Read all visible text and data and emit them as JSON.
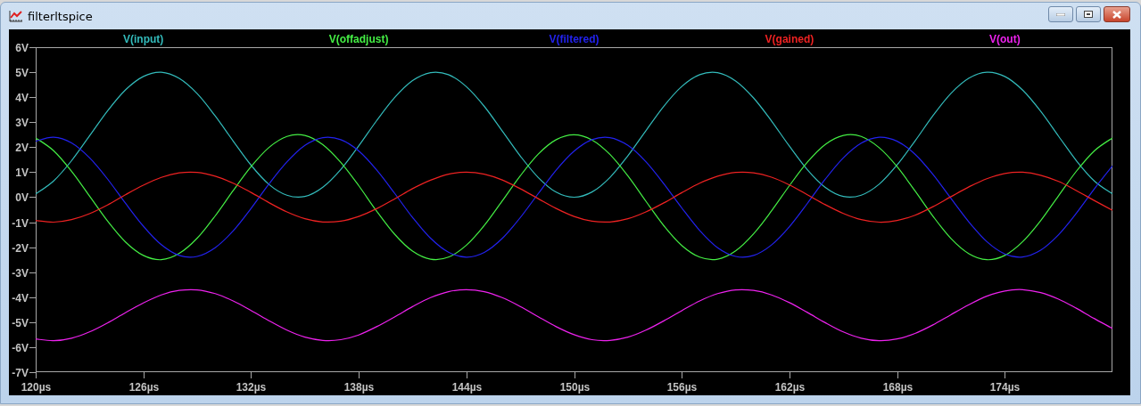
{
  "window": {
    "title": "filterltspice"
  },
  "plot": {
    "chart_data": {
      "type": "line",
      "x": [
        120,
        121,
        122,
        123,
        124,
        125,
        126,
        127,
        128,
        129,
        130,
        131,
        132,
        133,
        134,
        135,
        136,
        137,
        138,
        139,
        140,
        141,
        142,
        143,
        144,
        145,
        146,
        147,
        148,
        149,
        150,
        151,
        152,
        153,
        154,
        155,
        156,
        157,
        158,
        159,
        160,
        161,
        162,
        163,
        164,
        165,
        166,
        167,
        168,
        169,
        170,
        171,
        172,
        173,
        174,
        175,
        176,
        177,
        178,
        179,
        180
      ],
      "xlim": [
        120,
        180
      ],
      "ylim": [
        -7,
        6
      ],
      "xticks": [
        {
          "value": 120,
          "label": "120µs"
        },
        {
          "value": 126,
          "label": "126µs"
        },
        {
          "value": 132,
          "label": "132µs"
        },
        {
          "value": 138,
          "label": "138µs"
        },
        {
          "value": 144,
          "label": "144µs"
        },
        {
          "value": 150,
          "label": "150µs"
        },
        {
          "value": 156,
          "label": "156µs"
        },
        {
          "value": 162,
          "label": "162µs"
        },
        {
          "value": 168,
          "label": "168µs"
        },
        {
          "value": 174,
          "label": "174µs"
        }
      ],
      "yticks": [
        {
          "value": 6,
          "label": "6V"
        },
        {
          "value": 5,
          "label": "5V"
        },
        {
          "value": 4,
          "label": "4V"
        },
        {
          "value": 3,
          "label": "3V"
        },
        {
          "value": 2,
          "label": "2V"
        },
        {
          "value": 1,
          "label": "1V"
        },
        {
          "value": 0,
          "label": "0V"
        },
        {
          "value": -1,
          "label": "-1V"
        },
        {
          "value": -2,
          "label": "-2V"
        },
        {
          "value": -3,
          "label": "-3V"
        },
        {
          "value": -4,
          "label": "-4V"
        },
        {
          "value": -5,
          "label": "-5V"
        },
        {
          "value": -6,
          "label": "-6V"
        },
        {
          "value": -7,
          "label": "-7V"
        }
      ],
      "series": [
        {
          "name": "V(input)",
          "color": "#33bbbb",
          "values": [
            0.13,
            0.65,
            1.46,
            2.45,
            3.45,
            4.29,
            4.83,
            5.0,
            4.75,
            4.14,
            3.25,
            2.25,
            1.28,
            0.51,
            0.08,
            0.03,
            0.4,
            1.11,
            2.05,
            3.06,
            3.98,
            4.66,
            4.98,
            4.9,
            4.42,
            3.63,
            2.65,
            1.65,
            0.79,
            0.2,
            0.0,
            0.21,
            0.79,
            1.66,
            2.66,
            3.64,
            4.43,
            4.9,
            4.98,
            4.65,
            3.97,
            3.05,
            2.04,
            1.1,
            0.39,
            0.03,
            0.08,
            0.52,
            1.29,
            2.25,
            3.26,
            4.15,
            4.76,
            5.0,
            4.83,
            4.28,
            3.44,
            2.44,
            1.45,
            0.64,
            0.13
          ]
        },
        {
          "name": "V(offadjust)",
          "color": "#44ee44",
          "values": [
            2.37,
            1.86,
            1.04,
            0.05,
            -0.95,
            -1.79,
            -2.33,
            -2.5,
            -2.25,
            -1.64,
            -0.75,
            0.26,
            1.22,
            1.99,
            2.43,
            2.47,
            2.1,
            1.39,
            0.46,
            -0.56,
            -1.48,
            -2.16,
            -2.48,
            -2.4,
            -1.92,
            -1.13,
            -0.15,
            0.85,
            1.72,
            2.3,
            2.5,
            2.29,
            1.71,
            0.85,
            -0.16,
            -1.14,
            -1.93,
            -2.4,
            -2.48,
            -2.15,
            -1.47,
            -0.55,
            0.46,
            1.4,
            2.11,
            2.47,
            2.43,
            1.98,
            1.22,
            0.25,
            -0.76,
            -1.65,
            -2.26,
            -2.5,
            -2.33,
            -1.78,
            -0.94,
            0.06,
            1.05,
            1.86,
            2.37
          ]
        },
        {
          "name": "V(filtered)",
          "color": "#2222ee",
          "values": [
            2.24,
            2.4,
            2.17,
            1.58,
            0.73,
            -0.24,
            -1.16,
            -1.9,
            -2.33,
            -2.37,
            -2.02,
            -1.35,
            -0.45,
            0.53,
            1.41,
            2.07,
            2.38,
            2.3,
            1.85,
            1.09,
            0.16,
            -0.81,
            -1.64,
            -2.2,
            -2.4,
            -2.21,
            -1.65,
            -0.82,
            0.14,
            1.08,
            1.84,
            2.3,
            2.38,
            2.07,
            1.42,
            0.54,
            -0.43,
            -1.33,
            -2.02,
            -2.37,
            -2.33,
            -1.91,
            -1.18,
            -0.25,
            0.72,
            1.57,
            2.16,
            2.4,
            2.24,
            1.72,
            0.91,
            -0.05,
            -0.99,
            -1.78,
            -2.27,
            -2.39,
            -2.12,
            -1.5,
            -0.63,
            0.34,
            1.25
          ]
        },
        {
          "name": "V(gained)",
          "color": "#ee2222",
          "values": [
            -0.93,
            -1.0,
            -0.9,
            -0.66,
            -0.31,
            0.1,
            0.48,
            0.79,
            0.97,
            0.99,
            0.84,
            0.56,
            0.19,
            -0.22,
            -0.59,
            -0.86,
            -0.99,
            -0.96,
            -0.77,
            -0.46,
            -0.07,
            0.34,
            0.68,
            0.92,
            1.0,
            0.92,
            0.69,
            0.34,
            -0.06,
            -0.45,
            -0.77,
            -0.96,
            -0.99,
            -0.86,
            -0.59,
            -0.23,
            0.18,
            0.56,
            0.84,
            0.99,
            0.97,
            0.8,
            0.49,
            0.1,
            -0.3,
            -0.65,
            -0.9,
            -1.0,
            -0.93,
            -0.72,
            -0.38,
            0.02,
            0.41,
            0.74,
            0.95,
            1.0,
            0.88,
            0.63,
            0.26,
            -0.14,
            -0.52
          ]
        },
        {
          "name": "V(out)",
          "color": "#ee22ee",
          "values": [
            -5.67,
            -5.74,
            -5.64,
            -5.39,
            -5.03,
            -4.62,
            -4.23,
            -3.91,
            -3.73,
            -3.71,
            -3.86,
            -4.15,
            -4.53,
            -4.94,
            -5.32,
            -5.6,
            -5.73,
            -5.7,
            -5.51,
            -5.18,
            -4.79,
            -4.38,
            -4.02,
            -3.78,
            -3.7,
            -3.78,
            -4.02,
            -4.37,
            -4.78,
            -5.18,
            -5.5,
            -5.7,
            -5.73,
            -5.6,
            -5.32,
            -4.95,
            -4.54,
            -4.15,
            -3.86,
            -3.71,
            -3.73,
            -3.91,
            -4.22,
            -4.61,
            -5.02,
            -5.39,
            -5.64,
            -5.74,
            -5.67,
            -5.45,
            -5.11,
            -4.7,
            -4.3,
            -3.96,
            -3.75,
            -3.7,
            -3.82,
            -4.08,
            -4.45,
            -4.86,
            -5.25
          ]
        }
      ]
    }
  }
}
